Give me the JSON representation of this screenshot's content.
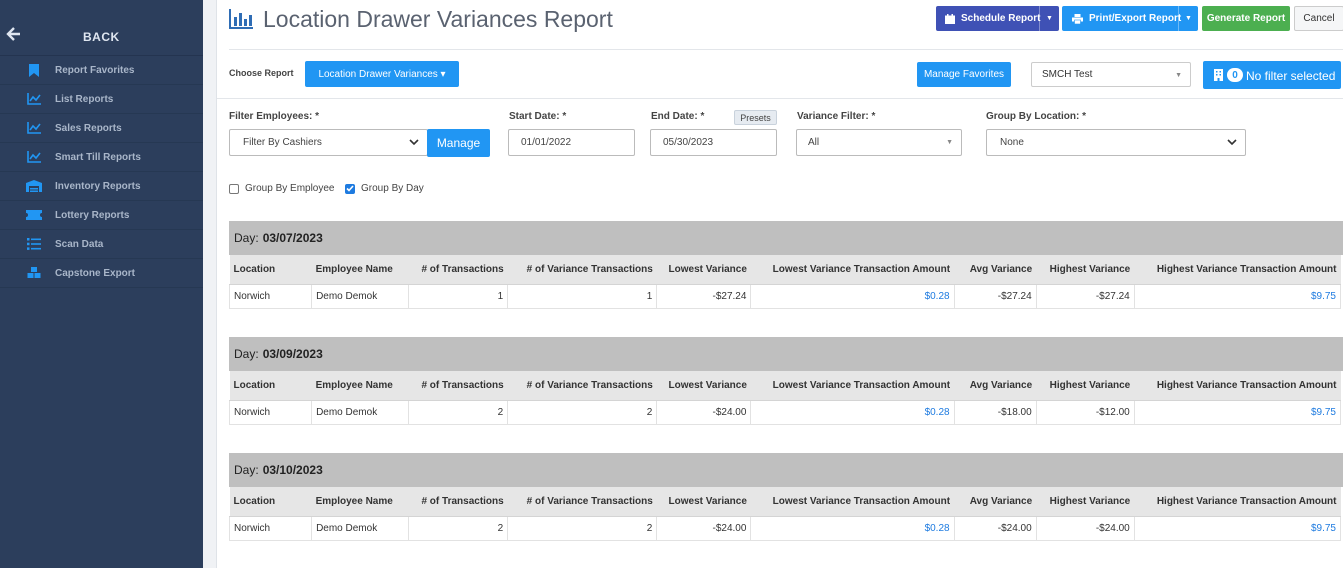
{
  "sidebar": {
    "back_label": "BACK",
    "items": [
      {
        "label": "Report Favorites",
        "icon": "bookmark-icon"
      },
      {
        "label": "List Reports",
        "icon": "line-chart-icon"
      },
      {
        "label": "Sales Reports",
        "icon": "line-chart-icon"
      },
      {
        "label": "Smart Till Reports",
        "icon": "line-chart-icon"
      },
      {
        "label": "Inventory Reports",
        "icon": "warehouse-icon"
      },
      {
        "label": "Lottery Reports",
        "icon": "ticket-icon"
      },
      {
        "label": "Scan Data",
        "icon": "list-icon"
      },
      {
        "label": "Capstone Export",
        "icon": "cubes-icon"
      }
    ]
  },
  "header": {
    "title": "Location Drawer Variances Report",
    "schedule_label": "Schedule Report",
    "print_label": "Print/Export Report",
    "generate_label": "Generate Report",
    "cancel_label": "Cancel"
  },
  "report_bar": {
    "choose_label": "Choose Report",
    "choose_value": "Location Drawer Variances ▾",
    "manage_favorites": "Manage Favorites",
    "store_value": "SMCH Test",
    "filter_count": "0",
    "filter_label": "No filter selected"
  },
  "filters": {
    "employees_label": "Filter Employees: *",
    "employees_value": "Filter By Cashiers",
    "manage_label": "Manage",
    "start_label": "Start Date: *",
    "start_value": "01/01/2022",
    "end_label": "End Date: *",
    "end_value": "05/30/2023",
    "presets_label": "Presets",
    "variance_label": "Variance Filter: *",
    "variance_value": "All",
    "group_loc_label": "Group By Location: *",
    "group_loc_value": "None",
    "group_employee_label": "Group By Employee",
    "group_employee_checked": false,
    "group_day_label": "Group By Day",
    "group_day_checked": true
  },
  "columns": [
    "Location",
    "Employee Name",
    "# of Transactions",
    "# of Variance Transactions",
    "Lowest Variance",
    "Lowest Variance Transaction Amount",
    "Avg Variance",
    "Highest Variance",
    "Highest Variance Transaction Amount"
  ],
  "day_prefix": "Day:",
  "groups": [
    {
      "day": "03/07/2023",
      "row": [
        "Norwich",
        "Demo Demok",
        "1",
        "1",
        "-$27.24",
        "$0.28",
        "-$27.24",
        "-$27.24",
        "$9.75"
      ]
    },
    {
      "day": "03/09/2023",
      "row": [
        "Norwich",
        "Demo Demok",
        "2",
        "2",
        "-$24.00",
        "$0.28",
        "-$18.00",
        "-$12.00",
        "$9.75"
      ]
    },
    {
      "day": "03/10/2023",
      "row": [
        "Norwich",
        "Demo Demok",
        "2",
        "2",
        "-$24.00",
        "$0.28",
        "-$24.00",
        "-$24.00",
        "$9.75"
      ]
    }
  ],
  "colors": {
    "sidebar_bg": "#2c3e5c",
    "primary": "#2196f3",
    "schedule": "#3f51b5",
    "generate": "#4caf50",
    "link": "#1e7be0"
  }
}
